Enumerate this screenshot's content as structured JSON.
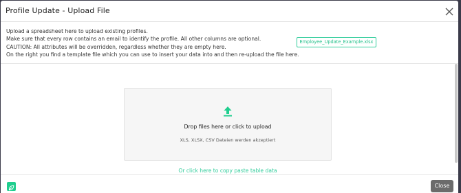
{
  "modal": {
    "title": "Profile Update - Upload File"
  },
  "info": {
    "lines": [
      "Upload a spreadsheet here to upload existing profiles.",
      "Make sure that every row contains an email to identify the profile. All other columns are optional.",
      "CAUTION: All attributes will be overridden, regardless whether they are empty here.",
      "On the right you find a template file which you can use to insert your data into and then re-upload the file here."
    ],
    "template_file": "Employee_Update_Example.xlsx"
  },
  "dropzone": {
    "title": "Drop files here or click to upload",
    "subtitle": "XLS, XLSX, CSV Dateien werden akzeptiert",
    "icon": "upload-icon"
  },
  "paste_link": "Or click here to copy paste table data",
  "footer": {
    "close_label": "Close",
    "leaf_icon": "leaf-icon"
  },
  "colors": {
    "accent": "#1fce8e",
    "close_button": "#6b6b6b"
  }
}
